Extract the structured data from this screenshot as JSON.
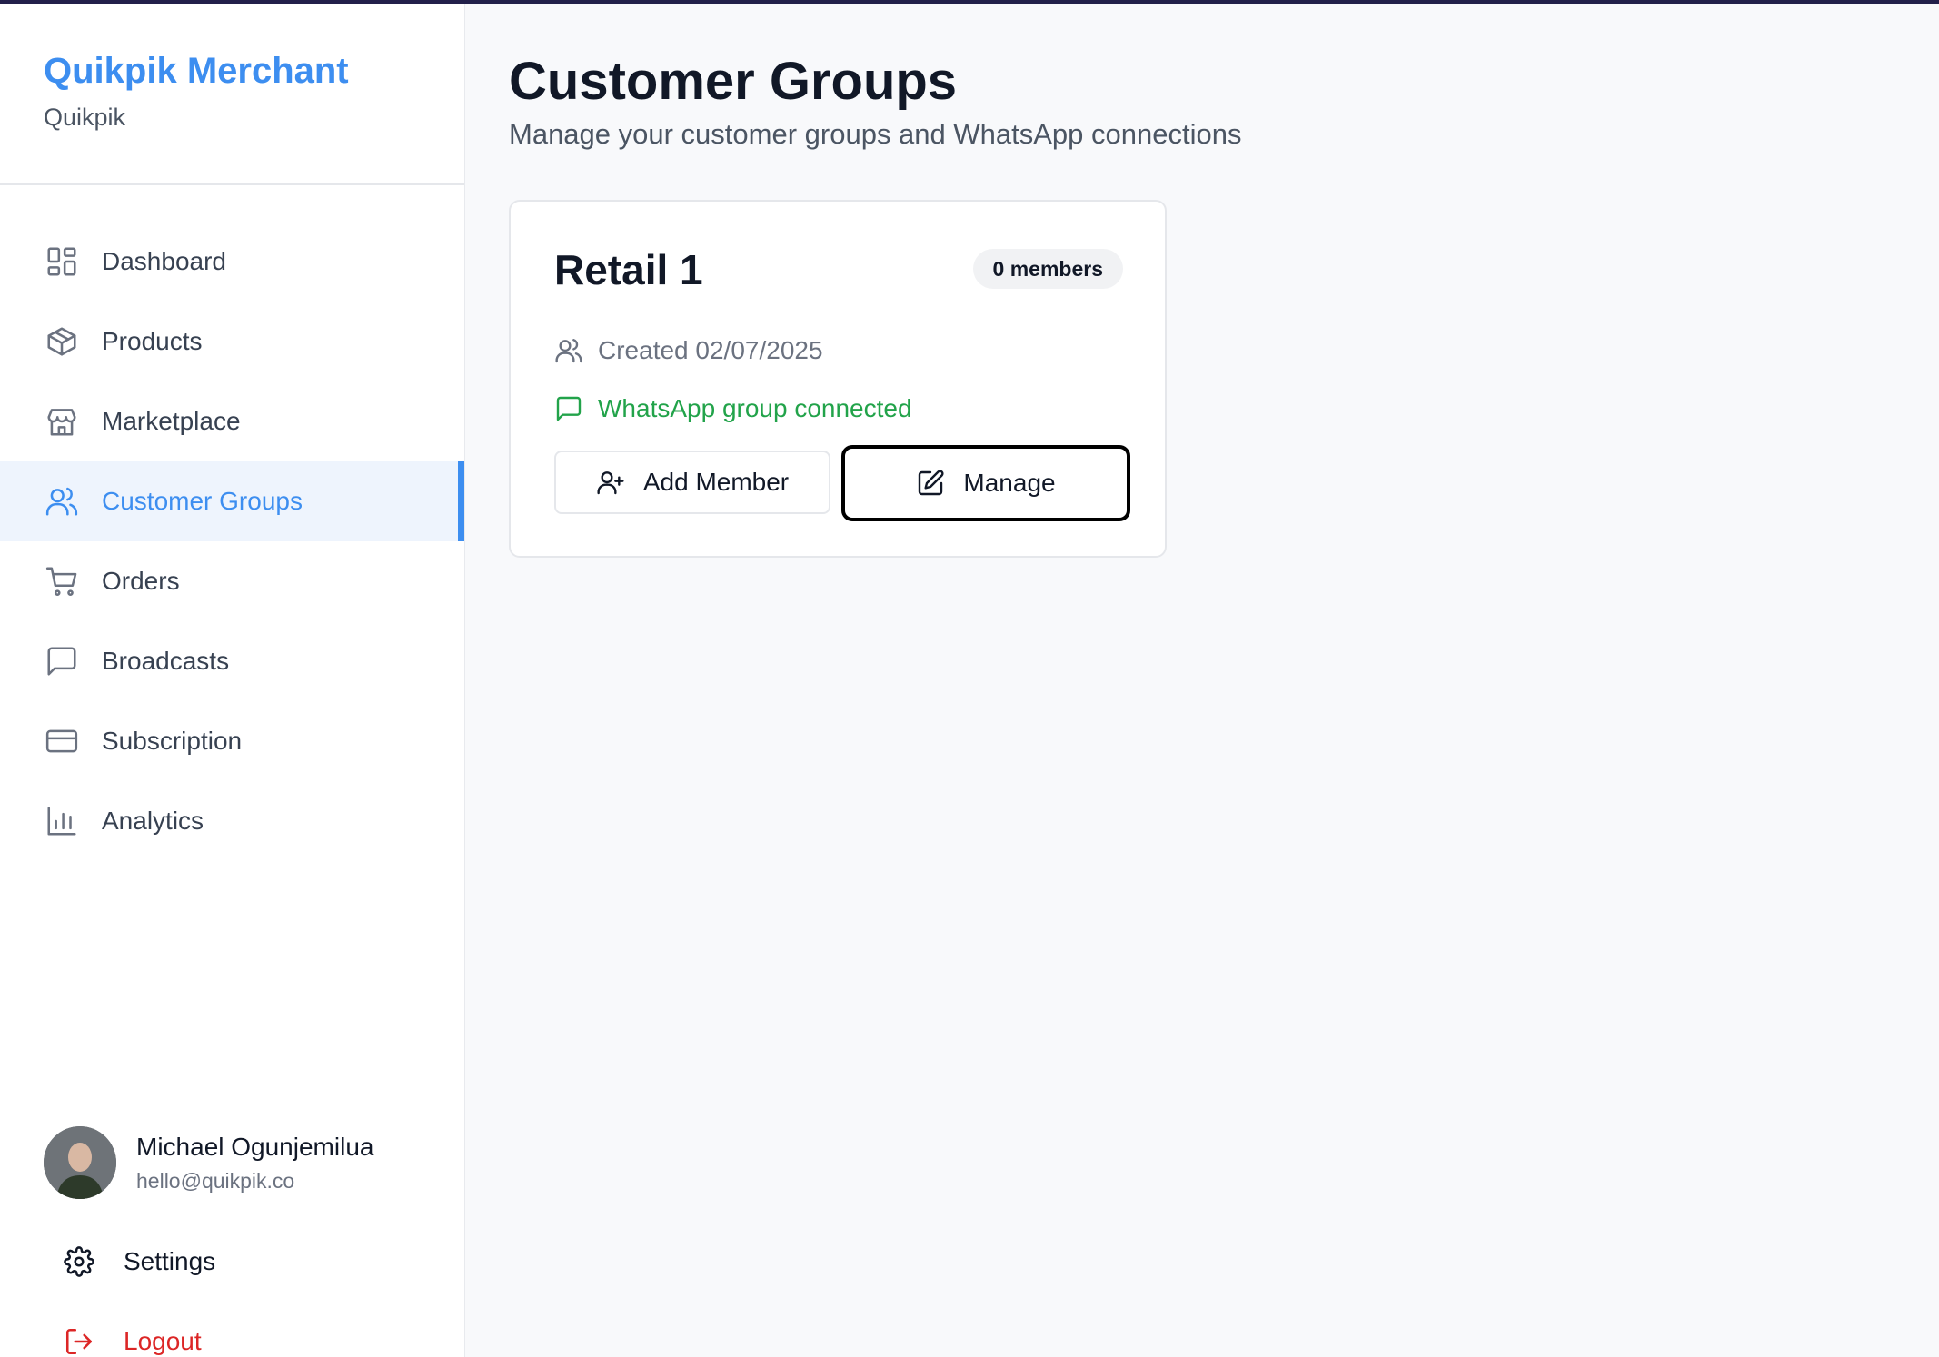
{
  "brand": {
    "title": "Quikpik Merchant",
    "subtitle": "Quikpik"
  },
  "nav": [
    {
      "label": "Dashboard",
      "icon": "dashboard-icon"
    },
    {
      "label": "Products",
      "icon": "package-icon"
    },
    {
      "label": "Marketplace",
      "icon": "store-icon"
    },
    {
      "label": "Customer Groups",
      "icon": "users-icon",
      "active": true
    },
    {
      "label": "Orders",
      "icon": "cart-icon"
    },
    {
      "label": "Broadcasts",
      "icon": "message-icon"
    },
    {
      "label": "Subscription",
      "icon": "credit-card-icon"
    },
    {
      "label": "Analytics",
      "icon": "bar-chart-icon"
    }
  ],
  "user": {
    "name": "Michael Ogunjemilua",
    "email": "hello@quikpik.co"
  },
  "footer": {
    "settings_label": "Settings",
    "logout_label": "Logout"
  },
  "page": {
    "title": "Customer Groups",
    "subtitle": "Manage your customer groups and WhatsApp connections"
  },
  "groups": [
    {
      "name": "Retail 1",
      "members_badge": "0 members",
      "created": "Created 02/07/2025",
      "whatsapp_status": "WhatsApp group connected",
      "add_member_label": "Add Member",
      "manage_label": "Manage"
    }
  ],
  "colors": {
    "accent": "#3d8ef0",
    "success": "#22a34a",
    "danger": "#dc2626",
    "text": "#111827",
    "muted": "#6b7280"
  }
}
